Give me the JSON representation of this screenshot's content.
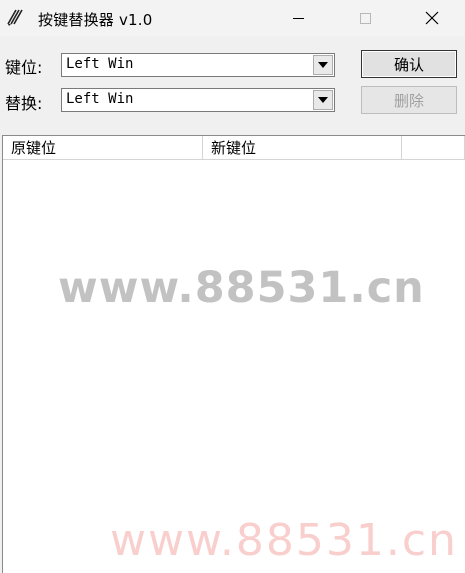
{
  "window": {
    "title": "按键替换器 v1.0",
    "icon": "pencil-stripes-icon",
    "controls": {
      "minimize": "minimize-icon",
      "maximize": "maximize-icon",
      "close": "close-icon"
    }
  },
  "form": {
    "key_label": "键位:",
    "replace_label": "替换:",
    "key_value": "Left Win",
    "replace_value": "Left Win"
  },
  "buttons": {
    "confirm": "确认",
    "delete": "删除"
  },
  "list": {
    "columns": [
      "原键位",
      "新键位",
      ""
    ],
    "rows": []
  },
  "watermarks": {
    "primary": "www.88531.cn",
    "secondary": "www.88531.cn"
  },
  "colors": {
    "background": "#f0f0f0",
    "watermark_gray": "#c2c2c2",
    "watermark_pink": "#f8cfcc",
    "disabled_text": "#a0a0a0"
  }
}
